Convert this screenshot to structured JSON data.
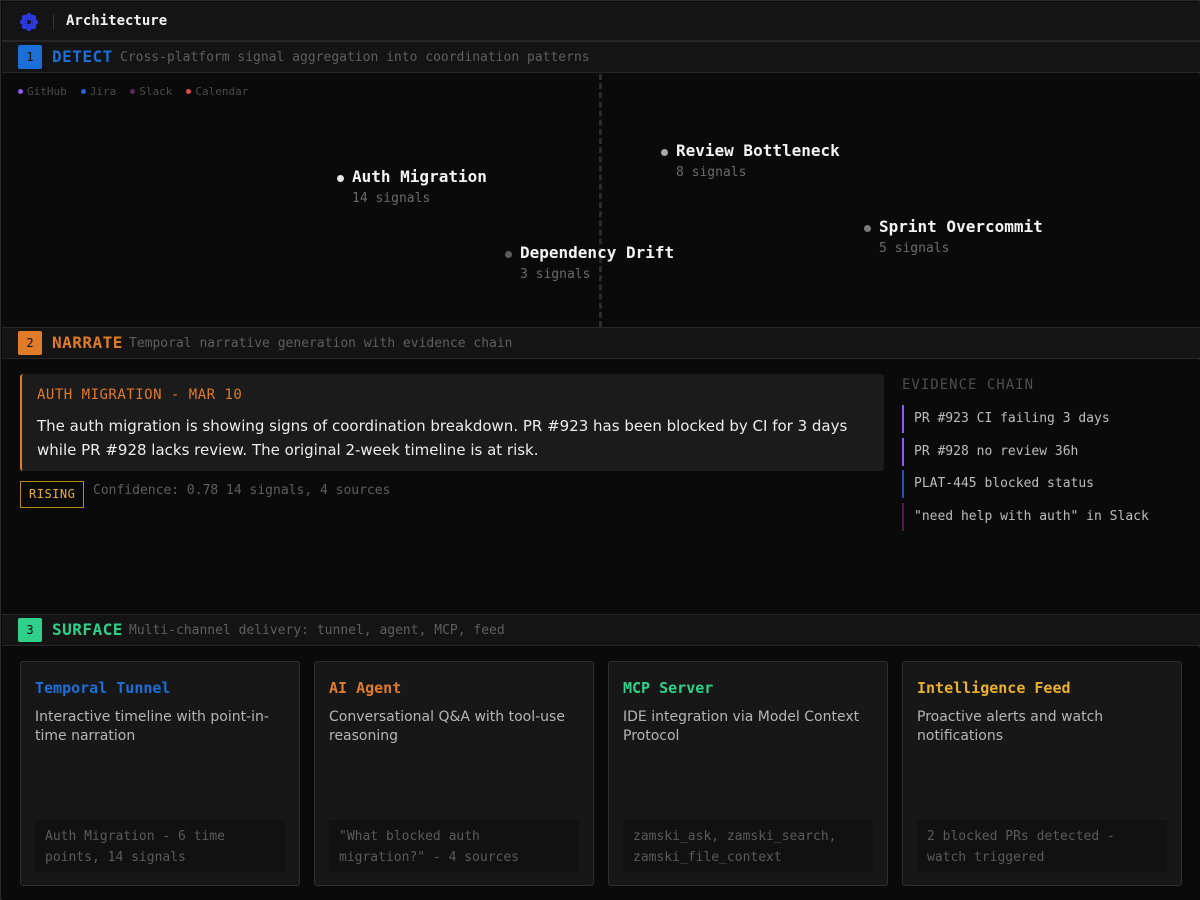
{
  "app": {
    "title": "Architecture",
    "logo_icon": "flower-gear-icon",
    "logo_color": "#2b39e0"
  },
  "stages": {
    "detect": {
      "number": "1",
      "name": "DETECT",
      "description": "Cross-platform signal aggregation into coordination patterns",
      "color": "#1d6fd8"
    },
    "narrate": {
      "number": "2",
      "name": "NARRATE",
      "description": "Temporal narrative generation with evidence chain",
      "color": "#e07b2a"
    },
    "surface": {
      "number": "3",
      "name": "SURFACE",
      "description": "Multi-channel delivery: tunnel, agent, MCP, feed",
      "color": "#2fd18a"
    }
  },
  "detect": {
    "legend": [
      {
        "label": "GitHub",
        "color": "#8a5cf5"
      },
      {
        "label": "Jira",
        "color": "#2a5fd8"
      },
      {
        "label": "Slack",
        "color": "#5a2a5a"
      },
      {
        "label": "Calendar",
        "color": "#e04a4a"
      }
    ],
    "clusters": [
      {
        "name": "Auth Migration",
        "signals": "14 signals",
        "dot_color": "#e6e6e6"
      },
      {
        "name": "Review Bottleneck",
        "signals": "8 signals",
        "dot_color": "#a8a8a8"
      },
      {
        "name": "Dependency Drift",
        "signals": "3 signals",
        "dot_color": "#5a5a5a"
      },
      {
        "name": "Sprint Overcommit",
        "signals": "5 signals",
        "dot_color": "#7a7a7a"
      }
    ]
  },
  "narrate": {
    "card_heading": "AUTH MIGRATION - MAR 10",
    "card_body": "The auth migration is showing signs of coordination breakdown. PR #923 has been blocked by CI for 3 days while PR #928 lacks review. The original 2-week timeline is at risk.",
    "status_badge": "RISING",
    "confidence": "Confidence: 0.78 14 signals, 4 sources",
    "evidence_title": "EVIDENCE CHAIN",
    "evidence": [
      {
        "text": "PR #923 CI failing 3 days",
        "color": "#8a5cf5"
      },
      {
        "text": "PR #928 no review 36h",
        "color": "#8a5cf5"
      },
      {
        "text": "PLAT-445 blocked status",
        "color": "#2a4fb0"
      },
      {
        "text": "\"need help with auth\" in Slack",
        "color": "#4a1f4a"
      }
    ]
  },
  "surface": {
    "cards": [
      {
        "title": "Temporal Tunnel",
        "description": "Interactive timeline with point-in-time narration",
        "footer": "Auth Migration - 6 time points, 14 signals",
        "color": "#1d6fd8"
      },
      {
        "title": "AI Agent",
        "description": "Conversational Q&A with tool-use reasoning",
        "footer": "\"What blocked auth migration?\" - 4 sources",
        "color": "#e07b2a"
      },
      {
        "title": "MCP Server",
        "description": "IDE integration via Model Context Protocol",
        "footer": "zamski_ask, zamski_search, zamski_file_context",
        "color": "#2fd18a"
      },
      {
        "title": "Intelligence Feed",
        "description": "Proactive alerts and watch notifications",
        "footer": "2 blocked PRs detected - watch triggered",
        "color": "#e9b030"
      }
    ]
  }
}
